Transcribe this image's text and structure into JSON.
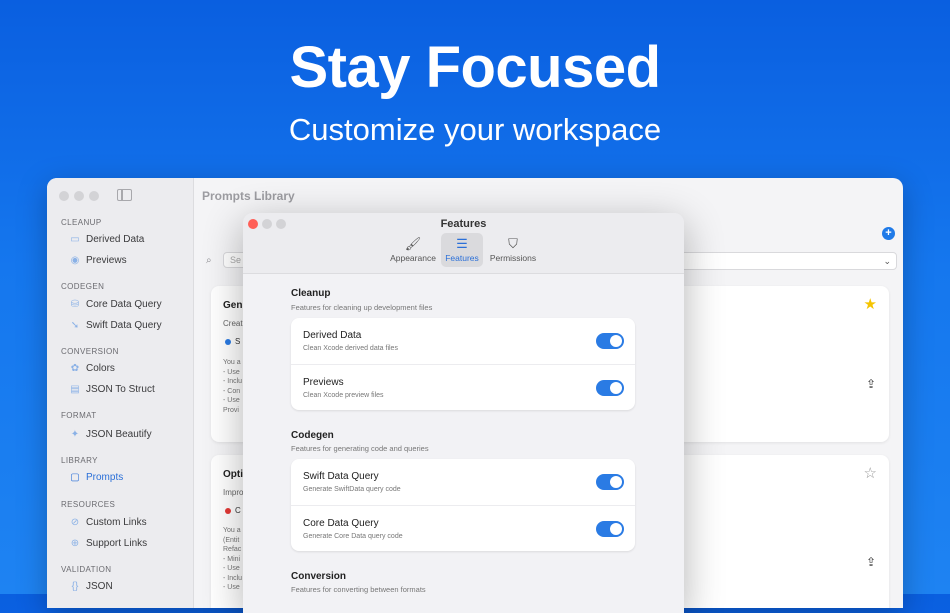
{
  "hero": {
    "title": "Stay Focused",
    "subtitle": "Customize your workspace"
  },
  "main_window": {
    "title": "Prompts Library",
    "search_placeholder": "Se",
    "sidebar": {
      "sections": [
        {
          "label": "CLEANUP",
          "items": [
            {
              "label": "Derived Data",
              "icon": "folder-icon"
            },
            {
              "label": "Previews",
              "icon": "eye-icon"
            }
          ]
        },
        {
          "label": "CODEGEN",
          "items": [
            {
              "label": "Core Data Query",
              "icon": "database-icon"
            },
            {
              "label": "Swift Data Query",
              "icon": "swift-icon"
            }
          ]
        },
        {
          "label": "CONVERSION",
          "items": [
            {
              "label": "Colors",
              "icon": "palette-icon"
            },
            {
              "label": "JSON To Struct",
              "icon": "document-icon"
            }
          ]
        },
        {
          "label": "FORMAT",
          "items": [
            {
              "label": "JSON Beautify",
              "icon": "sparkle-icon"
            }
          ]
        },
        {
          "label": "LIBRARY",
          "items": [
            {
              "label": "Prompts",
              "icon": "chat-icon",
              "active": true
            }
          ]
        },
        {
          "label": "RESOURCES",
          "items": [
            {
              "label": "Custom Links",
              "icon": "compass-icon"
            },
            {
              "label": "Support Links",
              "icon": "link-icon"
            }
          ]
        },
        {
          "label": "VALIDATION",
          "items": [
            {
              "label": "JSON",
              "icon": "braces-icon"
            }
          ]
        }
      ]
    },
    "cards": [
      {
        "title": "Gen",
        "desc": "Creat",
        "chip": "S",
        "chip_color": "#2a7be4",
        "body": "You a\n- Use\n- Inclu\n- Con\n- Use\nProvi",
        "starred": true
      },
      {
        "title": "Opti",
        "desc": "Impro",
        "chip": "C",
        "chip_color": "#e53935",
        "body": "You a\n(Entit\nRefac\n- Mini\n- Use\n- Inclu\n- Use",
        "starred": false
      }
    ]
  },
  "dialog": {
    "title": "Features",
    "tabs": [
      {
        "label": "Appearance",
        "icon": "paintbrush-icon",
        "selected": false
      },
      {
        "label": "Features",
        "icon": "switches-icon",
        "selected": true
      },
      {
        "label": "Permissions",
        "icon": "lock-shield-icon",
        "selected": false
      }
    ],
    "groups": [
      {
        "title": "Cleanup",
        "desc": "Features for cleaning up development files",
        "rows": [
          {
            "title": "Derived Data",
            "desc": "Clean Xcode derived data files",
            "on": true
          },
          {
            "title": "Previews",
            "desc": "Clean Xcode preview files",
            "on": true
          }
        ]
      },
      {
        "title": "Codegen",
        "desc": "Features for generating code and queries",
        "rows": [
          {
            "title": "Swift Data Query",
            "desc": "Generate SwiftData query code",
            "on": true
          },
          {
            "title": "Core Data Query",
            "desc": "Generate Core Data query code",
            "on": true
          }
        ]
      },
      {
        "title": "Conversion",
        "desc": "Features for converting between formats",
        "rows": []
      }
    ]
  },
  "colors": {
    "accent": "#2a7be4",
    "background_top": "#0a5fe0",
    "background_bottom": "#1e83f2",
    "star": "#f5c400"
  }
}
